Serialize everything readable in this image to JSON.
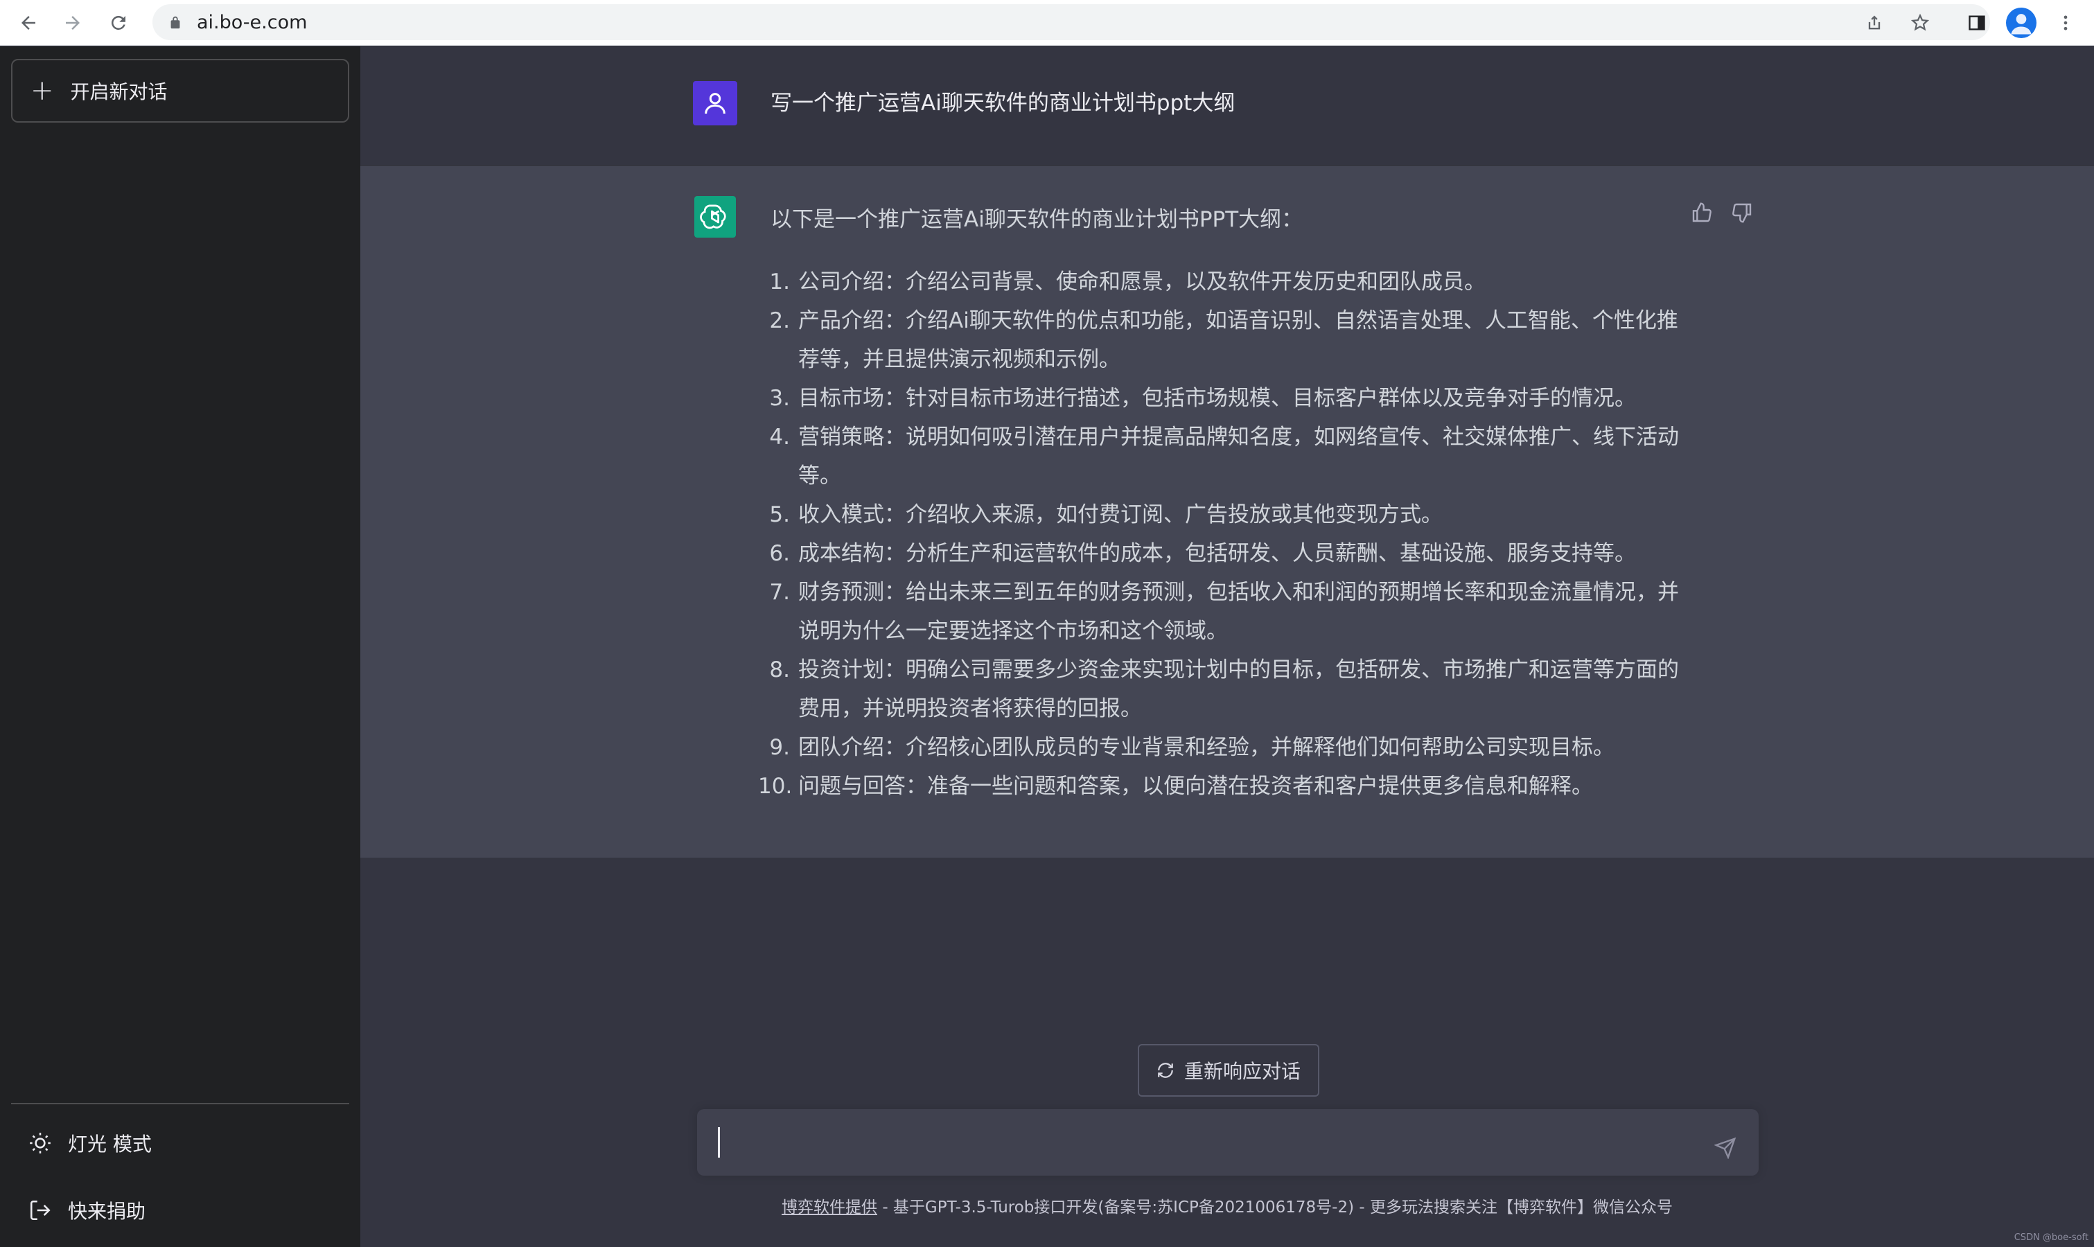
{
  "browser": {
    "url": "ai.bo-e.com"
  },
  "sidebar": {
    "new_chat_label": "开启新对话",
    "items": [
      {
        "label": "灯光 模式",
        "icon": "sun-icon"
      },
      {
        "label": "快来捐助",
        "icon": "logout-icon"
      }
    ]
  },
  "conversation": {
    "user_message": "写一个推广运营Ai聊天软件的商业计划书ppt大纲",
    "assistant_intro": "以下是一个推广运营Ai聊天软件的商业计划书PPT大纲：",
    "items": [
      {
        "num": "1.",
        "text": "公司介绍：介绍公司背景、使命和愿景，以及软件开发历史和团队成员。"
      },
      {
        "num": "2.",
        "text": "产品介绍：介绍Ai聊天软件的优点和功能，如语音识别、自然语言处理、人工智能、个性化推荐等，并且提供演示视频和示例。"
      },
      {
        "num": "3.",
        "text": "目标市场：针对目标市场进行描述，包括市场规模、目标客户群体以及竞争对手的情况。"
      },
      {
        "num": "4.",
        "text": "营销策略：说明如何吸引潜在用户并提高品牌知名度，如网络宣传、社交媒体推广、线下活动等。"
      },
      {
        "num": "5.",
        "text": "收入模式：介绍收入来源，如付费订阅、广告投放或其他变现方式。"
      },
      {
        "num": "6.",
        "text": "成本结构：分析生产和运营软件的成本，包括研发、人员薪酬、基础设施、服务支持等。"
      },
      {
        "num": "7.",
        "text": "财务预测：给出未来三到五年的财务预测，包括收入和利润的预期增长率和现金流量情况，并说明为什么一定要选择这个市场和这个领域。"
      },
      {
        "num": "8.",
        "text": "投资计划：明确公司需要多少资金来实现计划中的目标，包括研发、市场推广和运营等方面的费用，并说明投资者将获得的回报。"
      },
      {
        "num": "9.",
        "text": "团队介绍：介绍核心团队成员的专业背景和经验，并解释他们如何帮助公司实现目标。"
      },
      {
        "num": "10.",
        "text": "问题与回答：准备一些问题和答案，以便向潜在投资者和客户提供更多信息和解释。"
      }
    ]
  },
  "actions": {
    "regenerate_label": "重新响应对话",
    "input_value": ""
  },
  "footer": {
    "link_text": "博弈软件提供",
    "text": " - 基于GPT-3.5-Turob接口开发(备案号:苏ICP备2021006178号-2) - 更多玩法搜索关注【博弈软件】微信公众号"
  },
  "watermark": "CSDN @boe-soft",
  "colors": {
    "sidebar_bg": "#202123",
    "main_bg": "#343541",
    "assistant_bg": "#444654",
    "user_avatar": "#5436da",
    "gpt_avatar": "#10a37f"
  }
}
